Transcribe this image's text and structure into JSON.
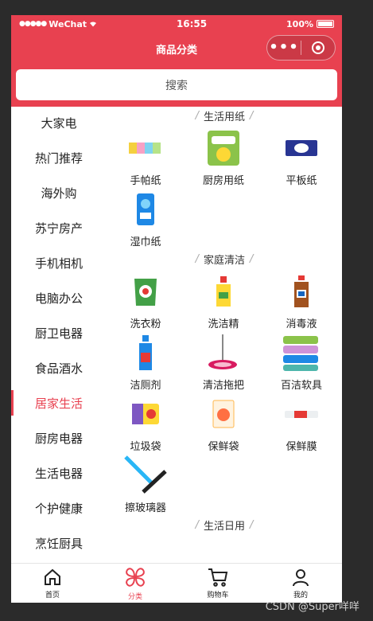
{
  "status": {
    "carrier": "WeChat",
    "time": "16:55",
    "battery": "100%"
  },
  "nav": {
    "title": "商品分类"
  },
  "search": {
    "placeholder": "搜索"
  },
  "sidebar": {
    "items": [
      "大家电",
      "热门推荐",
      "海外购",
      "苏宁房产",
      "手机相机",
      "电脑办公",
      "厨卫电器",
      "食品酒水",
      "居家生活",
      "厨房电器",
      "生活电器",
      "个护健康",
      "烹饪厨具"
    ],
    "active": "居家生活"
  },
  "sections": [
    {
      "title": "生活用纸",
      "products": [
        "手帕纸",
        "厨房用纸",
        "平板纸",
        "湿巾纸"
      ]
    },
    {
      "title": "家庭清洁",
      "products": [
        "洗衣粉",
        "洗洁精",
        "消毒液",
        "洁厕剂",
        "清洁拖把",
        "百洁软具",
        "垃圾袋",
        "保鲜袋",
        "保鲜膜",
        "擦玻璃器"
      ]
    },
    {
      "title": "生活日用",
      "products": []
    }
  ],
  "tabbar": {
    "items": [
      "首页",
      "分类",
      "购物车",
      "我的"
    ],
    "active": "分类"
  },
  "watermark": "CSDN @Super咩咩",
  "colors": {
    "brand": "#e84150"
  }
}
